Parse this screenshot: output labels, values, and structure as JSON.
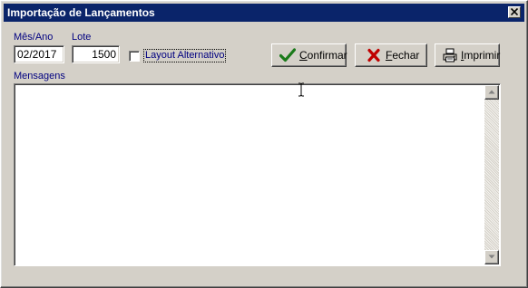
{
  "window": {
    "title": "Importação de Lançamentos",
    "close_icon": "close-icon"
  },
  "form": {
    "mes_ano": {
      "label": "Mês/Ano",
      "value": "02/2017"
    },
    "lote": {
      "label": "Lote",
      "value": "1500"
    },
    "layout_alternativo": {
      "label": "Layout Alternativo",
      "checked": false
    }
  },
  "buttons": {
    "confirmar": {
      "prefix": "",
      "accel": "C",
      "rest": "onfirmar",
      "icon": "check-icon"
    },
    "fechar": {
      "prefix": "",
      "accel": "F",
      "rest": "echar",
      "icon": "x-icon"
    },
    "imprimir": {
      "prefix": "",
      "accel": "I",
      "rest": "mprimir",
      "icon": "printer-icon"
    }
  },
  "mensagens": {
    "label": "Mensagens",
    "content": ""
  },
  "colors": {
    "titlebar": "#0a246a",
    "face": "#d4d0c8",
    "check_green": "#1a7a1a",
    "x_red": "#c00000",
    "label_blue": "#000080"
  }
}
